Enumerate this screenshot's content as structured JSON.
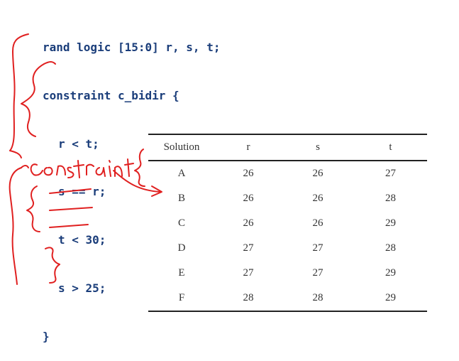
{
  "code": {
    "lines": [
      "rand logic [15:0] r, s, t;",
      "constraint c_bidir {",
      "r < t;",
      "s == r;",
      "t < 30;",
      "s > 25;",
      "}"
    ]
  },
  "annotation": {
    "handwritten_text": "constraint {",
    "ink_color": "#e02020"
  },
  "table": {
    "headers": [
      "Solution",
      "r",
      "s",
      "t"
    ],
    "rows": [
      [
        "A",
        "26",
        "26",
        "27"
      ],
      [
        "B",
        "26",
        "26",
        "28"
      ],
      [
        "C",
        "26",
        "26",
        "29"
      ],
      [
        "D",
        "27",
        "27",
        "28"
      ],
      [
        "E",
        "27",
        "27",
        "29"
      ],
      [
        "F",
        "28",
        "28",
        "29"
      ]
    ]
  }
}
